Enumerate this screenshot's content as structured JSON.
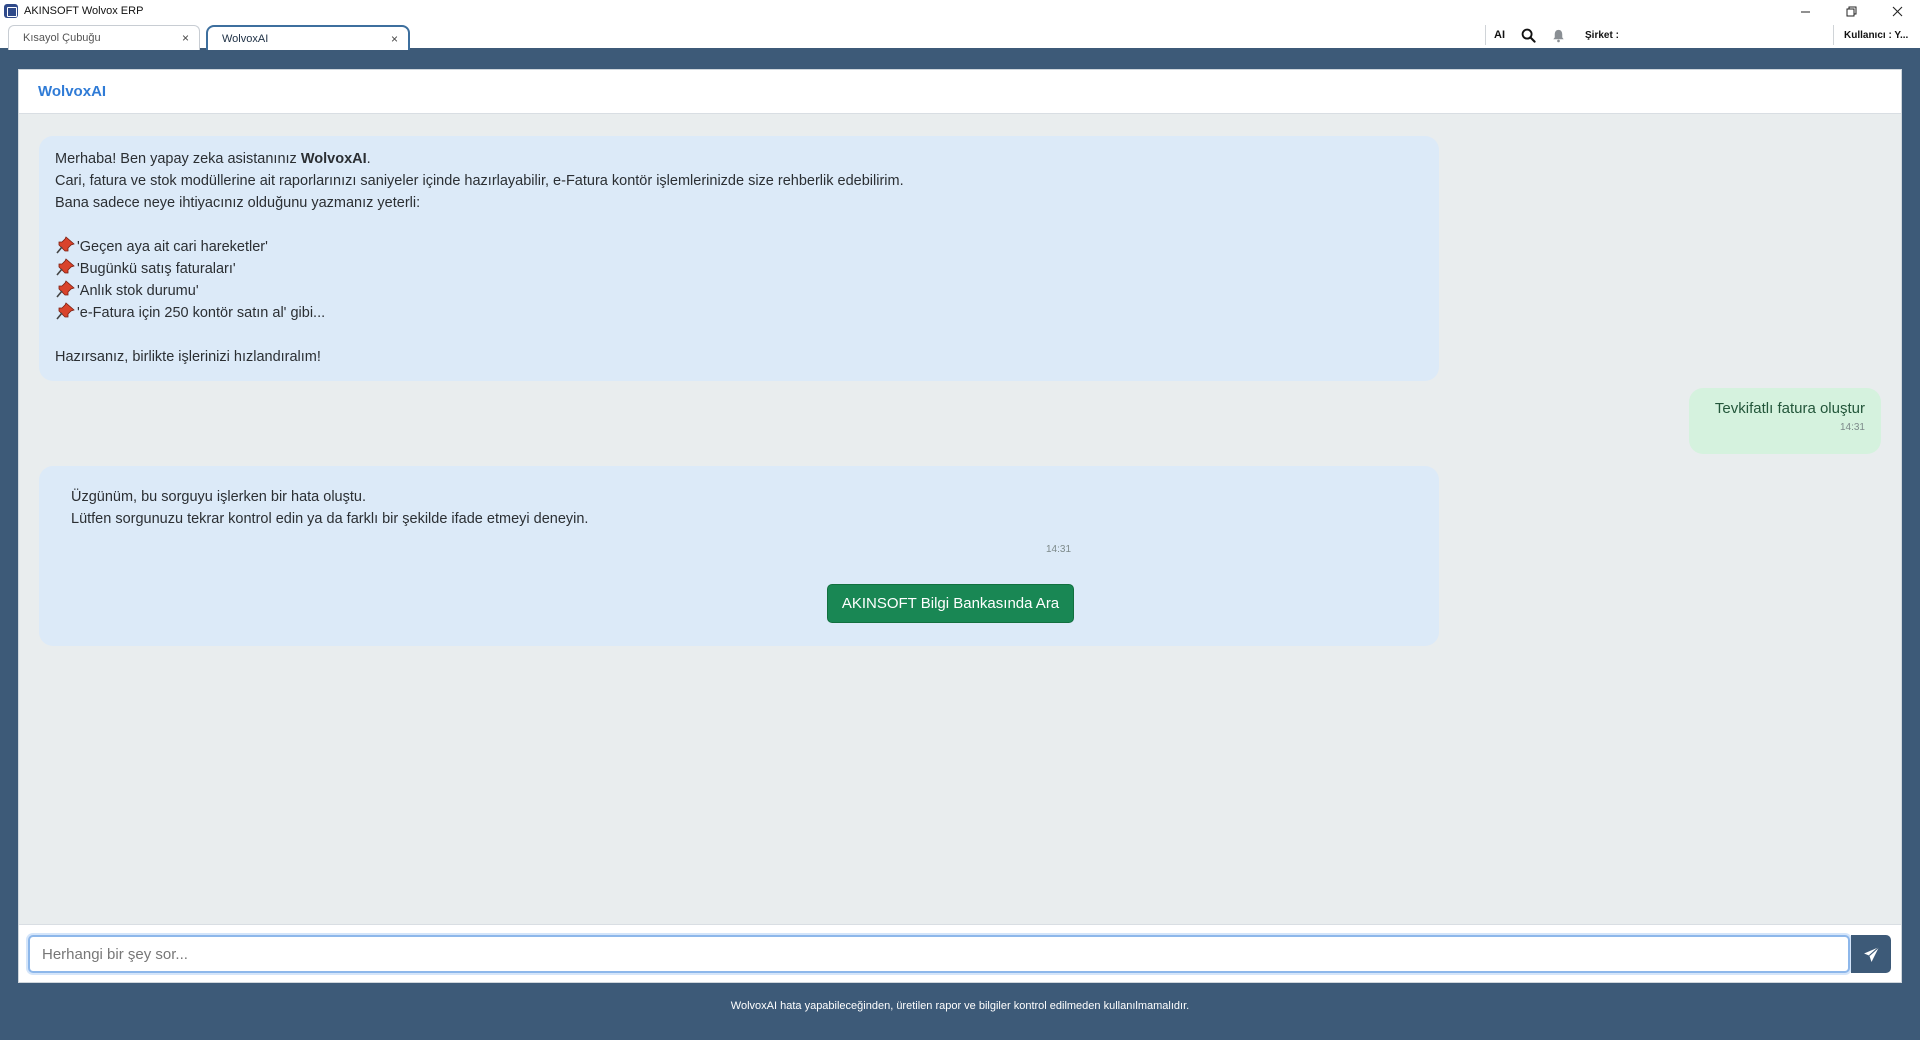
{
  "window": {
    "title": "AKINSOFT Wolvox ERP",
    "controls": {
      "minimize": "—",
      "restore": "❐",
      "close": "✕"
    }
  },
  "tabs": [
    {
      "label": "Kısayol Çubuğu",
      "close": "×"
    },
    {
      "label": "WolvoxAI",
      "close": "×"
    }
  ],
  "topbar": {
    "ai_label": "AI",
    "company_label": "Şirket :",
    "user_label": "Kullanıcı : Y..."
  },
  "panel": {
    "title": "WolvoxAI"
  },
  "messages": {
    "welcome": {
      "greeting_prefix": "Merhaba! Ben yapay zeka asistanınız ",
      "greeting_name": "WolvoxAI",
      "greeting_suffix": ".",
      "line2": "Cari, fatura ve stok modüllerine ait raporlarınızı saniyeler içinde hazırlayabilir, e-Fatura kontör işlemlerinizde size rehberlik edebilirim.",
      "line3": "Bana sadece neye ihtiyacınız olduğunu yazmanız yeterli:",
      "examples": [
        "'Geçen aya ait cari hareketler'",
        "'Bugünkü satış faturaları'",
        "'Anlık stok durumu'",
        "'e-Fatura için 250 kontör satın al' gibi..."
      ],
      "closing": "Hazırsanız, birlikte işlerinizi hızlandıralım!"
    },
    "user_msg": {
      "text": "Tevkifatlı fatura oluştur",
      "time": "14:31"
    },
    "error_msg": {
      "line1": "Üzgünüm, bu sorguyu işlerken bir hata oluştu.",
      "line2": "Lütfen sorgunuzu tekrar kontrol edin ya da farklı bir şekilde ifade etmeyi deneyin.",
      "time": "14:31",
      "button_label": "AKINSOFT Bilgi Bankasında Ara"
    }
  },
  "input": {
    "placeholder": "Herhangi bir şey sor...",
    "value": ""
  },
  "footer": {
    "note": "WolvoxAI hata yapabileceğinden, üretilen rapor ve bilgiler kontrol edilmeden kullanılmamalıdır."
  },
  "colors": {
    "frame": "#3d5a78",
    "accent_title": "#2f7bd6",
    "ai_bubble": "#dceaf8",
    "user_bubble": "#d5f2de",
    "kb_button": "#198754",
    "pin": "#d9432b"
  },
  "icons": {
    "app": "app-icon",
    "search": "search-icon",
    "bell": "bell-icon",
    "pin": "pushpin-icon",
    "send": "send-icon"
  }
}
